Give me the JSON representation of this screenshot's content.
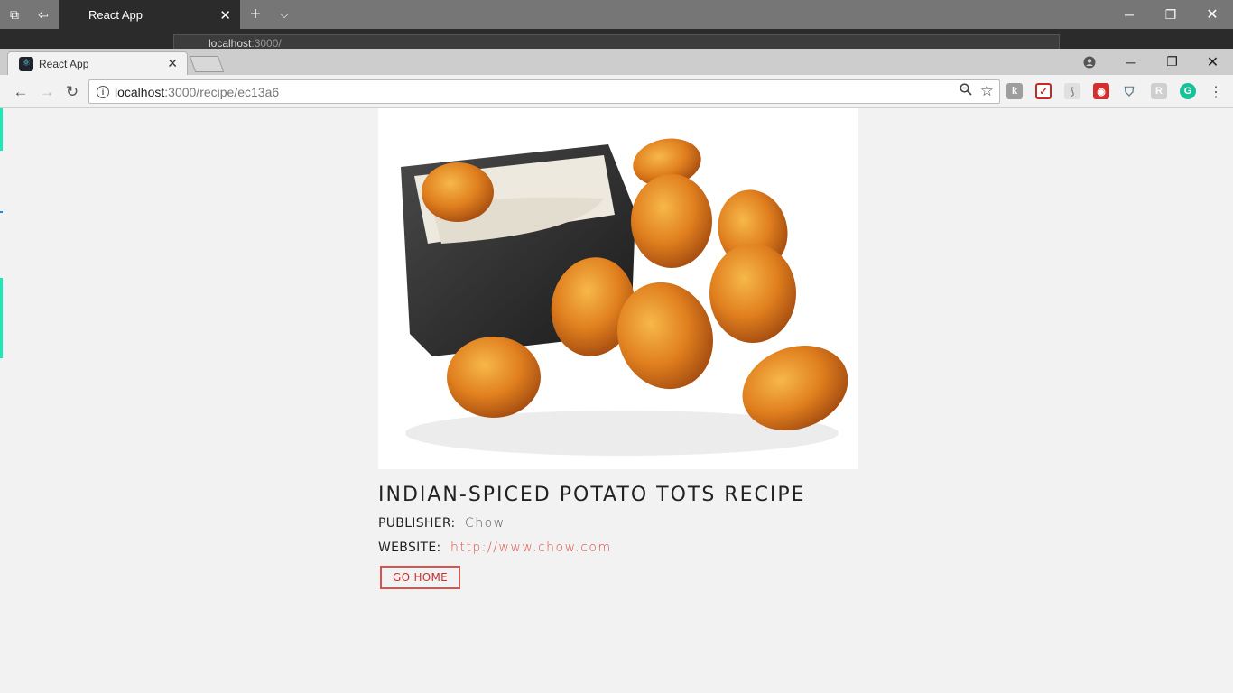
{
  "edge": {
    "tab_title": "React App",
    "address": "localhost",
    "address_port": ":3000/"
  },
  "chrome": {
    "tab_title": "React App",
    "url_host": "localhost",
    "url_path": ":3000/recipe/ec13a6"
  },
  "recipe": {
    "title": "INDIAN-SPICED POTATO TOTS RECIPE",
    "publisher_label": "PUBLISHER:",
    "publisher": "Chow",
    "website_label": "WEBSITE:",
    "website": "http://www.chow.com",
    "go_home_label": "GO HOME"
  },
  "colors": {
    "accent": "#d9534f",
    "page_bg": "#f2f2f2"
  }
}
